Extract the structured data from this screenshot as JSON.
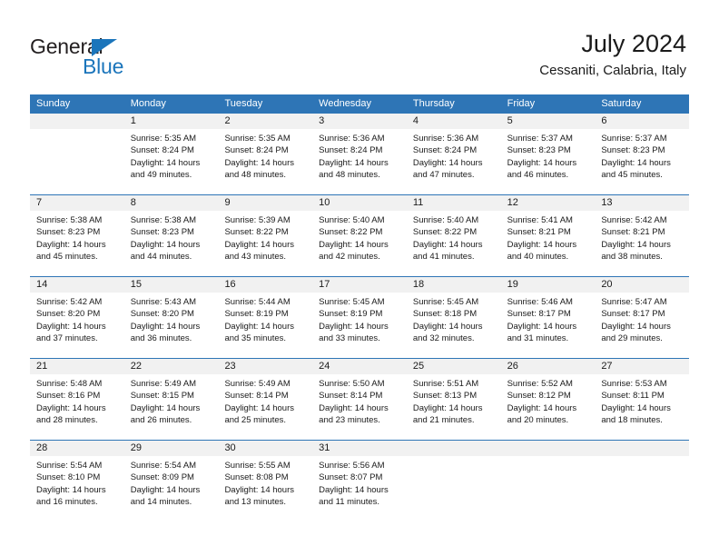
{
  "brand": {
    "name_part1": "General",
    "name_part2": "Blue",
    "triangle_icon": "triangle-icon",
    "accent_color": "#1b75bb"
  },
  "header": {
    "title": "July 2024",
    "subtitle": "Cessaniti, Calabria, Italy"
  },
  "theme": {
    "header_bg": "#2e75b6",
    "header_text": "#ffffff",
    "daynum_band_bg": "#f1f1f1",
    "cell_bg": "#ffffff",
    "text": "#1a1a1a"
  },
  "weekdays": [
    "Sunday",
    "Monday",
    "Tuesday",
    "Wednesday",
    "Thursday",
    "Friday",
    "Saturday"
  ],
  "weeks": [
    [
      {
        "day": "",
        "lines": []
      },
      {
        "day": "1",
        "lines": [
          "Sunrise: 5:35 AM",
          "Sunset: 8:24 PM",
          "Daylight: 14 hours",
          "and 49 minutes."
        ]
      },
      {
        "day": "2",
        "lines": [
          "Sunrise: 5:35 AM",
          "Sunset: 8:24 PM",
          "Daylight: 14 hours",
          "and 48 minutes."
        ]
      },
      {
        "day": "3",
        "lines": [
          "Sunrise: 5:36 AM",
          "Sunset: 8:24 PM",
          "Daylight: 14 hours",
          "and 48 minutes."
        ]
      },
      {
        "day": "4",
        "lines": [
          "Sunrise: 5:36 AM",
          "Sunset: 8:24 PM",
          "Daylight: 14 hours",
          "and 47 minutes."
        ]
      },
      {
        "day": "5",
        "lines": [
          "Sunrise: 5:37 AM",
          "Sunset: 8:23 PM",
          "Daylight: 14 hours",
          "and 46 minutes."
        ]
      },
      {
        "day": "6",
        "lines": [
          "Sunrise: 5:37 AM",
          "Sunset: 8:23 PM",
          "Daylight: 14 hours",
          "and 45 minutes."
        ]
      }
    ],
    [
      {
        "day": "7",
        "lines": [
          "Sunrise: 5:38 AM",
          "Sunset: 8:23 PM",
          "Daylight: 14 hours",
          "and 45 minutes."
        ]
      },
      {
        "day": "8",
        "lines": [
          "Sunrise: 5:38 AM",
          "Sunset: 8:23 PM",
          "Daylight: 14 hours",
          "and 44 minutes."
        ]
      },
      {
        "day": "9",
        "lines": [
          "Sunrise: 5:39 AM",
          "Sunset: 8:22 PM",
          "Daylight: 14 hours",
          "and 43 minutes."
        ]
      },
      {
        "day": "10",
        "lines": [
          "Sunrise: 5:40 AM",
          "Sunset: 8:22 PM",
          "Daylight: 14 hours",
          "and 42 minutes."
        ]
      },
      {
        "day": "11",
        "lines": [
          "Sunrise: 5:40 AM",
          "Sunset: 8:22 PM",
          "Daylight: 14 hours",
          "and 41 minutes."
        ]
      },
      {
        "day": "12",
        "lines": [
          "Sunrise: 5:41 AM",
          "Sunset: 8:21 PM",
          "Daylight: 14 hours",
          "and 40 minutes."
        ]
      },
      {
        "day": "13",
        "lines": [
          "Sunrise: 5:42 AM",
          "Sunset: 8:21 PM",
          "Daylight: 14 hours",
          "and 38 minutes."
        ]
      }
    ],
    [
      {
        "day": "14",
        "lines": [
          "Sunrise: 5:42 AM",
          "Sunset: 8:20 PM",
          "Daylight: 14 hours",
          "and 37 minutes."
        ]
      },
      {
        "day": "15",
        "lines": [
          "Sunrise: 5:43 AM",
          "Sunset: 8:20 PM",
          "Daylight: 14 hours",
          "and 36 minutes."
        ]
      },
      {
        "day": "16",
        "lines": [
          "Sunrise: 5:44 AM",
          "Sunset: 8:19 PM",
          "Daylight: 14 hours",
          "and 35 minutes."
        ]
      },
      {
        "day": "17",
        "lines": [
          "Sunrise: 5:45 AM",
          "Sunset: 8:19 PM",
          "Daylight: 14 hours",
          "and 33 minutes."
        ]
      },
      {
        "day": "18",
        "lines": [
          "Sunrise: 5:45 AM",
          "Sunset: 8:18 PM",
          "Daylight: 14 hours",
          "and 32 minutes."
        ]
      },
      {
        "day": "19",
        "lines": [
          "Sunrise: 5:46 AM",
          "Sunset: 8:17 PM",
          "Daylight: 14 hours",
          "and 31 minutes."
        ]
      },
      {
        "day": "20",
        "lines": [
          "Sunrise: 5:47 AM",
          "Sunset: 8:17 PM",
          "Daylight: 14 hours",
          "and 29 minutes."
        ]
      }
    ],
    [
      {
        "day": "21",
        "lines": [
          "Sunrise: 5:48 AM",
          "Sunset: 8:16 PM",
          "Daylight: 14 hours",
          "and 28 minutes."
        ]
      },
      {
        "day": "22",
        "lines": [
          "Sunrise: 5:49 AM",
          "Sunset: 8:15 PM",
          "Daylight: 14 hours",
          "and 26 minutes."
        ]
      },
      {
        "day": "23",
        "lines": [
          "Sunrise: 5:49 AM",
          "Sunset: 8:14 PM",
          "Daylight: 14 hours",
          "and 25 minutes."
        ]
      },
      {
        "day": "24",
        "lines": [
          "Sunrise: 5:50 AM",
          "Sunset: 8:14 PM",
          "Daylight: 14 hours",
          "and 23 minutes."
        ]
      },
      {
        "day": "25",
        "lines": [
          "Sunrise: 5:51 AM",
          "Sunset: 8:13 PM",
          "Daylight: 14 hours",
          "and 21 minutes."
        ]
      },
      {
        "day": "26",
        "lines": [
          "Sunrise: 5:52 AM",
          "Sunset: 8:12 PM",
          "Daylight: 14 hours",
          "and 20 minutes."
        ]
      },
      {
        "day": "27",
        "lines": [
          "Sunrise: 5:53 AM",
          "Sunset: 8:11 PM",
          "Daylight: 14 hours",
          "and 18 minutes."
        ]
      }
    ],
    [
      {
        "day": "28",
        "lines": [
          "Sunrise: 5:54 AM",
          "Sunset: 8:10 PM",
          "Daylight: 14 hours",
          "and 16 minutes."
        ]
      },
      {
        "day": "29",
        "lines": [
          "Sunrise: 5:54 AM",
          "Sunset: 8:09 PM",
          "Daylight: 14 hours",
          "and 14 minutes."
        ]
      },
      {
        "day": "30",
        "lines": [
          "Sunrise: 5:55 AM",
          "Sunset: 8:08 PM",
          "Daylight: 14 hours",
          "and 13 minutes."
        ]
      },
      {
        "day": "31",
        "lines": [
          "Sunrise: 5:56 AM",
          "Sunset: 8:07 PM",
          "Daylight: 14 hours",
          "and 11 minutes."
        ]
      },
      {
        "day": "",
        "lines": []
      },
      {
        "day": "",
        "lines": []
      },
      {
        "day": "",
        "lines": []
      }
    ]
  ]
}
